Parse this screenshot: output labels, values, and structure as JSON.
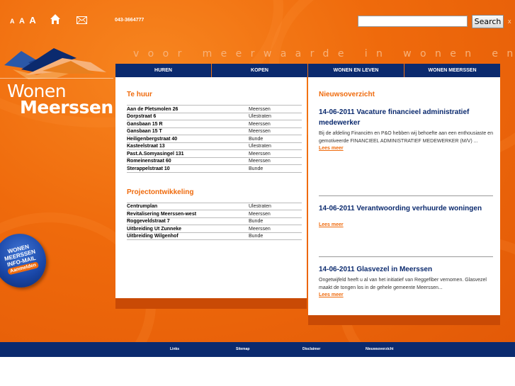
{
  "header": {
    "font_size_labels": [
      "A",
      "A",
      "A"
    ],
    "phone": "043-3664777",
    "search": {
      "value": "",
      "placeholder": "",
      "button_label": "Search",
      "close_label": "x"
    }
  },
  "logo": {
    "line1": "Wonen",
    "line2": "Meerssen"
  },
  "tagline": "voor meerwaarde in wonen en leven",
  "nav": [
    "HUREN",
    "KOPEN",
    "WONEN EN LEVEN",
    "WONEN MEERSSEN"
  ],
  "te_huur": {
    "title": "Te huur",
    "rows": [
      {
        "address": "Aan de Pletsmolen 26",
        "town": "Meerssen"
      },
      {
        "address": "Dorpstraat 6",
        "town": "Ulestraten"
      },
      {
        "address": "Gansbaan 15 R",
        "town": "Meerssen"
      },
      {
        "address": "Gansbaan 15 T",
        "town": "Meerssen"
      },
      {
        "address": "Heiligenbergstraat 40",
        "town": "Bunde"
      },
      {
        "address": "Kasteelstraat 13",
        "town": "Ulestraten"
      },
      {
        "address": "Past.A.Somyasingel 131",
        "town": "Meerssen"
      },
      {
        "address": "Romeinenstraat 60",
        "town": "Meerssen"
      },
      {
        "address": "Sterappelstraat 10",
        "town": "Bunde"
      }
    ]
  },
  "projecten": {
    "title": "Projectontwikkeling",
    "rows": [
      {
        "address": "Centrumplan",
        "town": "Ulestraten"
      },
      {
        "address": "Revitalisering Meerssen-west",
        "town": "Meerssen"
      },
      {
        "address": "Roggeveldstraat 7",
        "town": "Bunde"
      },
      {
        "address": "Uitbreiding Ut Zunneke",
        "town": "Meerssen"
      },
      {
        "address": "Uitbreiding Wilgenhof",
        "town": "Bunde"
      }
    ]
  },
  "news": {
    "title": "Nieuwsoverzicht",
    "items": [
      {
        "headline": "14-06-2011 Vacature financieel administratief medewerker",
        "body": "Bij de afdeling Financiën en P&O hebben wij behoefte aan een enthousiaste en gemotiveerde FINANCIEEL ADMINISTRATIEF MEDEWERKER (M/V) ...",
        "more": "Lees meer"
      },
      {
        "headline": "14-06-2011 Verantwoording verhuurde woningen",
        "body": "",
        "more": "Lees meer"
      },
      {
        "headline": "14-06-2011 Glasvezel in Meerssen",
        "body": "Ongetwijfeld heeft u al van het initiatief van Reggefiber vernomen. Glasvezel maakt de tongen los in de gehele gemeente Meerssen...",
        "more": "Lees meer"
      }
    ]
  },
  "badge": {
    "lines": [
      "WONEN",
      "MEERSSEN",
      "INFO-MAIL"
    ],
    "button": "Aanmelden"
  },
  "footer": [
    "Links",
    "Sitemap",
    "Disclaimer",
    "Nieuwsoverzicht"
  ],
  "colors": {
    "orange": "#ef6a0c",
    "navy": "#0b2a6e"
  }
}
